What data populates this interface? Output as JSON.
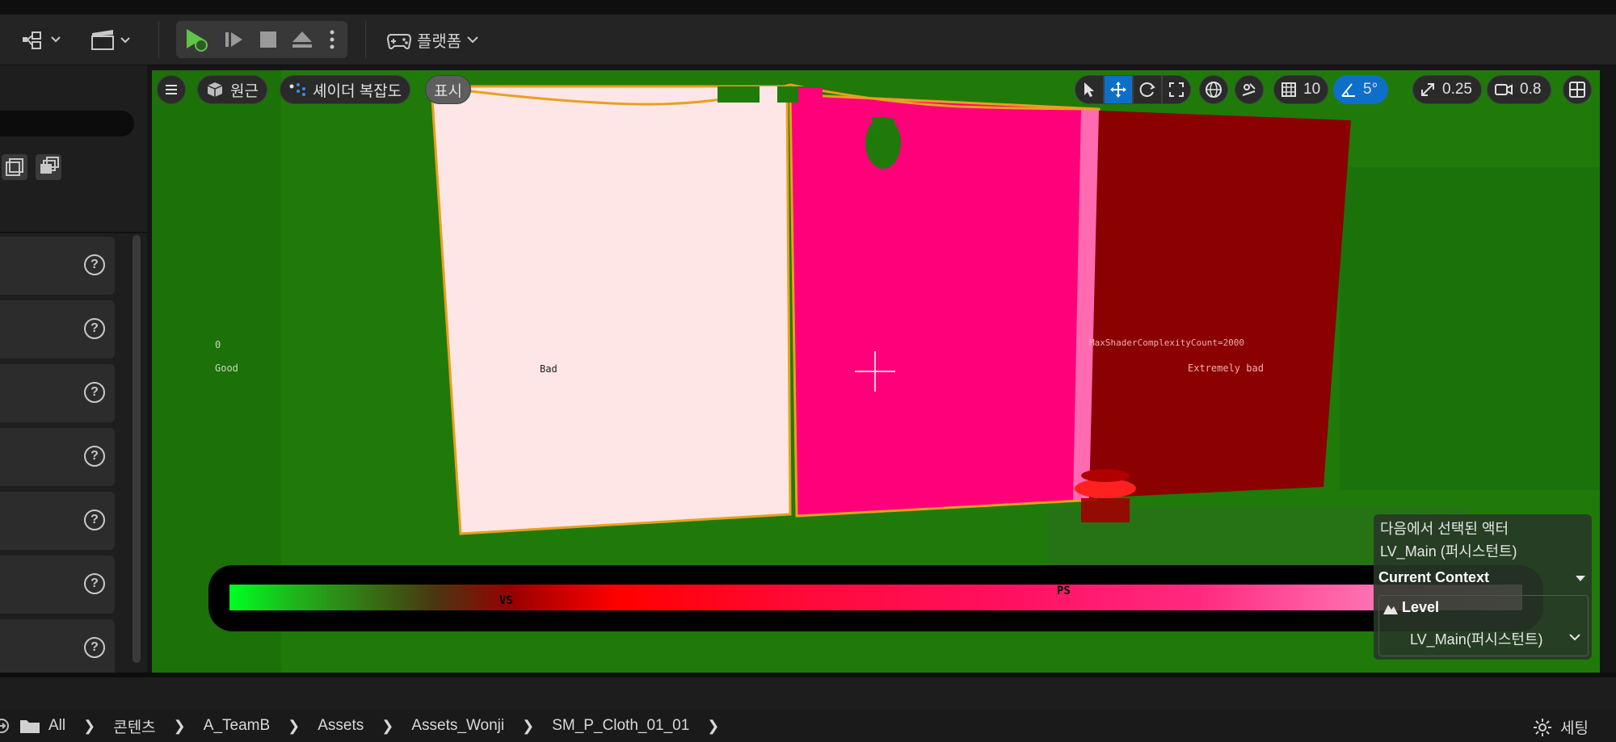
{
  "toolbar": {
    "platform_label": "플랫폼"
  },
  "viewport": {
    "perspective_label": "원근",
    "viewmode_label": "셰이더 복잡도",
    "show_label": "표시",
    "grid_snap_value": "10",
    "angle_snap_value": "5°",
    "scale_snap_value": "0.25",
    "camera_speed_value": "0.8",
    "scene_labels": {
      "zero": "0",
      "good": "Good",
      "bad": "Bad",
      "max_count": "MaxShaderComplexityCount=2000",
      "extremely_bad": "Extremely bad"
    },
    "legend": {
      "vs_label": "VS",
      "ps_label": "PS"
    }
  },
  "selection_panel": {
    "title_line1": "다음에서 선택된 액터",
    "title_line2": "LV_Main (퍼시스턴트)",
    "context_label": "Current Context",
    "level_label": "Level",
    "level_value": "LV_Main(퍼시스턴트)"
  },
  "path_bar": {
    "crumbs": [
      "All",
      "콘텐츠",
      "A_TeamB",
      "Assets",
      "Assets_Wonji",
      "SM_P_Cloth_01_01"
    ],
    "settings_label": "세팅"
  },
  "colors": {
    "viewport_bg": "#1f7a0a",
    "accent": "#0e6fc9",
    "play_green": "#5fc447"
  }
}
